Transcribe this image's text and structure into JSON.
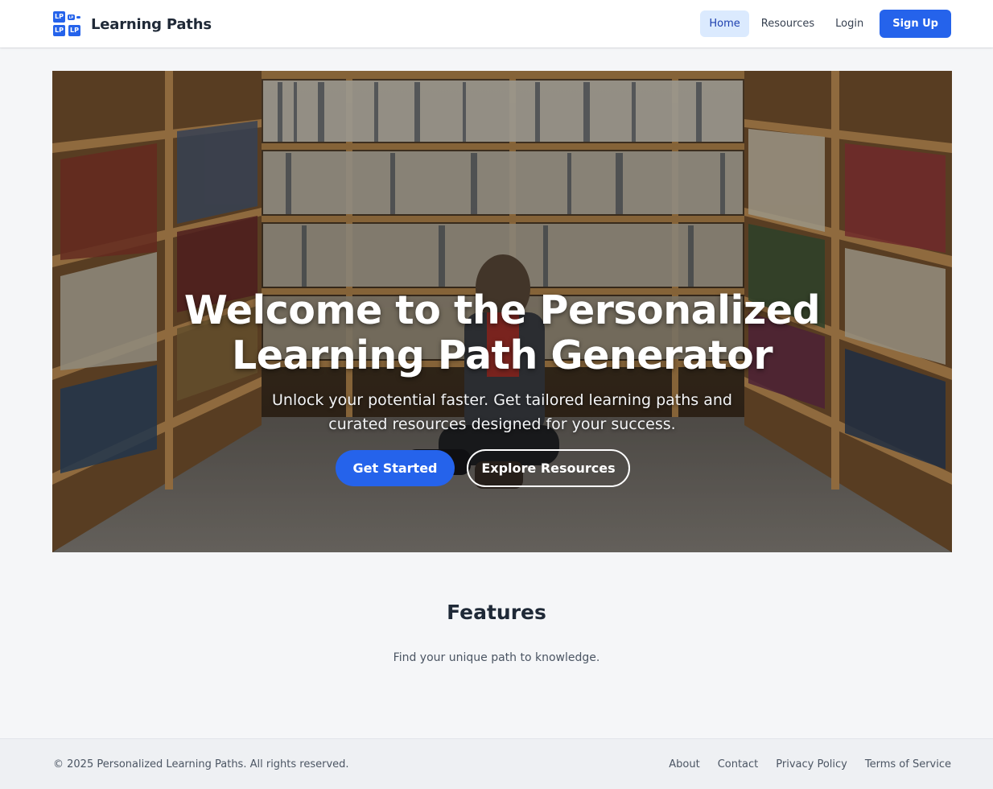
{
  "header": {
    "logo": {
      "icon": "lp-logo-icon",
      "tile_text": "LP"
    },
    "brand": "Learning Paths",
    "nav": [
      {
        "label": "Home",
        "active": true
      },
      {
        "label": "Resources",
        "active": false
      },
      {
        "label": "Login",
        "active": false
      }
    ],
    "signup_label": "Sign Up"
  },
  "hero": {
    "background": "library-bookshelves-photo",
    "title": "Welcome to the Personalized Learning Path Generator",
    "subtitle": "Unlock your potential faster. Get tailored learning paths and curated resources designed for your success.",
    "primary_button": "Get Started",
    "secondary_button": "Explore Resources"
  },
  "features": {
    "title": "Features",
    "subtitle": "Find your unique path to knowledge."
  },
  "footer": {
    "copyright": "© 2025 Personalized Learning Paths. All rights reserved.",
    "links": [
      "About",
      "Contact",
      "Privacy Policy",
      "Terms of Service"
    ]
  },
  "colors": {
    "accent": "#2563eb",
    "active_nav_bg": "#dbeafe",
    "page_bg": "#f5f6f8",
    "footer_bg": "#eef0f3"
  }
}
